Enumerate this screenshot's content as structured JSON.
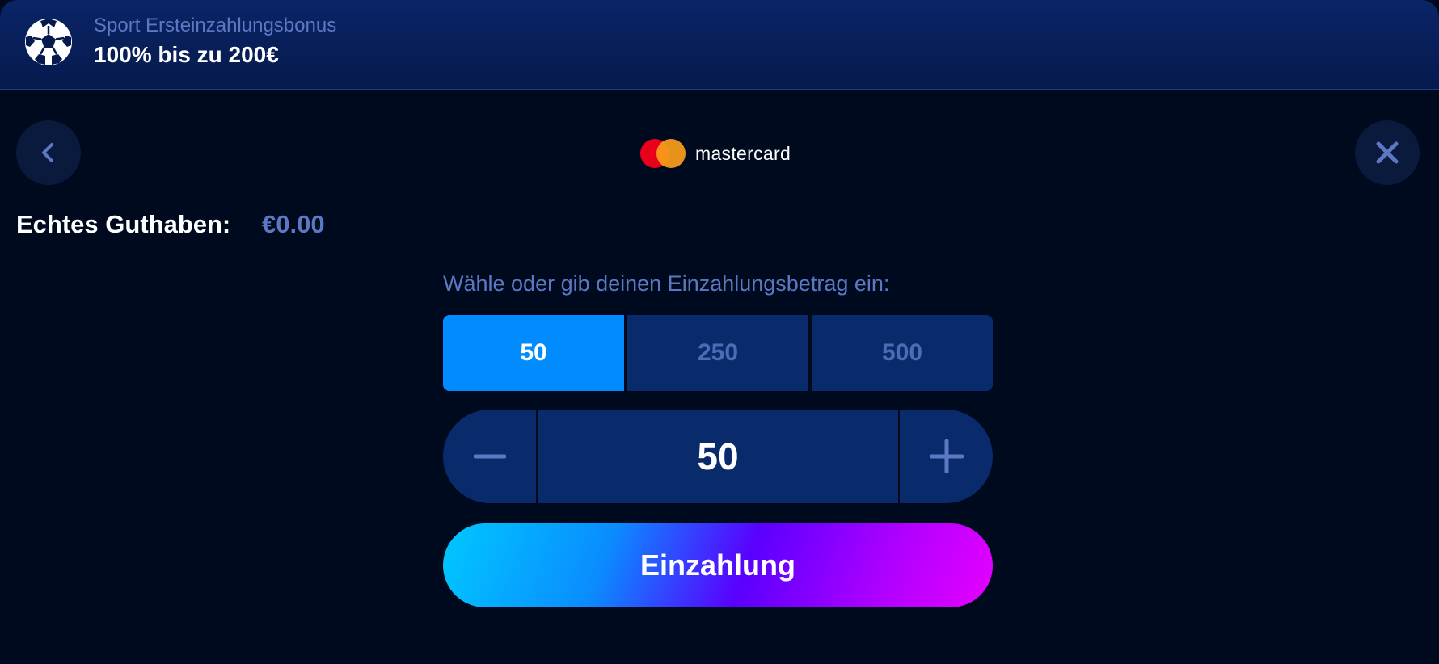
{
  "banner": {
    "subtitle": "Sport Ersteinzahlungsbonus",
    "title": "100% bis zu 200€",
    "icon": "soccer-ball-icon"
  },
  "header": {
    "back_icon": "chevron-left-icon",
    "close_icon": "close-icon",
    "logo_text": "mastercard"
  },
  "balance": {
    "label": "Echtes Guthaben:",
    "value": "€0.00"
  },
  "deposit": {
    "prompt": "Wähle oder gib deinen Einzahlungsbetrag ein:",
    "presets": [
      {
        "label": "50",
        "selected": true
      },
      {
        "label": "250",
        "selected": false
      },
      {
        "label": "500",
        "selected": false
      }
    ],
    "amount": "50",
    "button_label": "Einzahlung"
  },
  "colors": {
    "accent": "#008cff",
    "panel_bg": "#000a1e",
    "control_bg": "#0a2b6b",
    "muted_text": "#5c78c2"
  }
}
